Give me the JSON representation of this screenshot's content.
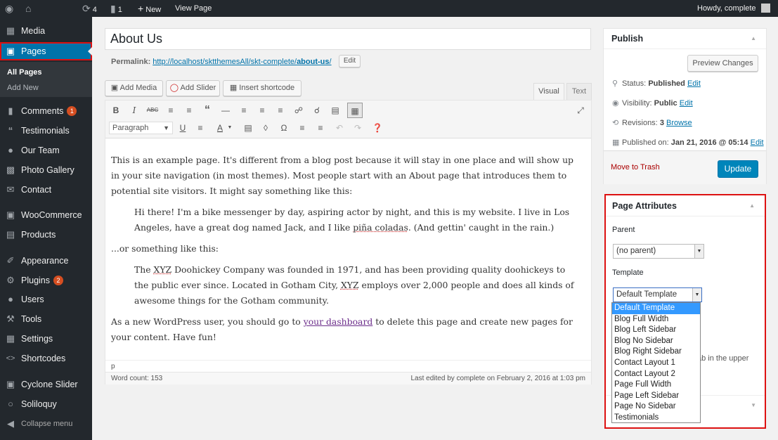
{
  "adminbar": {
    "updates_count": "4",
    "comments_count": "1",
    "new_label": "New",
    "view_page_label": "View Page",
    "howdy": "Howdy, complete"
  },
  "sidebar": {
    "items": [
      {
        "label": "Media",
        "icon": "media-icon"
      },
      {
        "label": "Pages",
        "icon": "pages-icon"
      },
      {
        "label": "Comments",
        "icon": "comments-icon",
        "badge": "1"
      },
      {
        "label": "Testimonials",
        "icon": "quote-icon"
      },
      {
        "label": "Our Team",
        "icon": "team-icon"
      },
      {
        "label": "Photo Gallery",
        "icon": "gallery-icon"
      },
      {
        "label": "Contact",
        "icon": "envelope-icon"
      },
      {
        "label": "WooCommerce",
        "icon": "woocommerce-icon"
      },
      {
        "label": "Products",
        "icon": "cart-icon"
      },
      {
        "label": "Appearance",
        "icon": "brush-icon"
      },
      {
        "label": "Plugins",
        "icon": "plugin-icon",
        "badge": "2"
      },
      {
        "label": "Users",
        "icon": "user-icon"
      },
      {
        "label": "Tools",
        "icon": "wrench-icon"
      },
      {
        "label": "Settings",
        "icon": "settings-icon"
      },
      {
        "label": "Shortcodes",
        "icon": "code-icon"
      },
      {
        "label": "Cyclone Slider",
        "icon": "slider-icon"
      },
      {
        "label": "Soliloquy",
        "icon": "soliloquy-icon"
      },
      {
        "label": "Collapse menu",
        "icon": "collapse-icon"
      }
    ],
    "submenu": {
      "all_pages": "All Pages",
      "add_new": "Add New"
    }
  },
  "editor": {
    "title": "About Us",
    "permalink_label": "Permalink:",
    "permalink_base": "http://localhost/sktthemesAll/skt-complete/",
    "permalink_slug": "about-us",
    "permalink_tail": "/",
    "edit_label": "Edit",
    "add_media": "Add Media",
    "add_slider": "Add Slider",
    "insert_shortcode": "Insert shortcode",
    "tab_visual": "Visual",
    "tab_text": "Text",
    "format": "Paragraph",
    "content": {
      "p1": "This is an example page. It's different from a blog post because it will stay in one place and will show up in your site navigation (in most themes). Most people start with an About page that introduces them to potential site visitors. It might say something like this:",
      "quote1_a": "Hi there! I'm a bike messenger by day, aspiring actor by night, and this is my website. I live in Los Angeles, have a great dog named Jack, and I like ",
      "quote1_b": "piña coladas",
      "quote1_c": ". (And gettin' caught in the rain.)",
      "p2": "...or something like this:",
      "quote2_a": "The ",
      "quote2_b": "XYZ",
      "quote2_c": " Doohickey Company was founded in 1971, and has been providing quality doohickeys to the public ever since. Located in Gotham City, ",
      "quote2_d": "XYZ",
      "quote2_e": " employs over 2,000 people and does all kinds of awesome things for the Gotham community.",
      "p3_a": "As a new WordPress user, you should go to ",
      "p3_link": "your dashboard",
      "p3_b": " to delete this page and create new pages for your content. Have fun!"
    },
    "path": "p",
    "word_count": "Word count: 153",
    "last_edited": "Last edited by complete on February 2, 2016 at 1:03 pm"
  },
  "publish": {
    "title": "Publish",
    "preview": "Preview Changes",
    "status_label": "Status:",
    "status_value": "Published",
    "visibility_label": "Visibility:",
    "visibility_value": "Public",
    "revisions_label": "Revisions:",
    "revisions_value": "3",
    "browse": "Browse",
    "published_label": "Published on:",
    "published_value": "Jan 21, 2016 @ 05:14",
    "edit": "Edit",
    "trash": "Move to Trash",
    "update": "Update"
  },
  "attributes": {
    "title": "Page Attributes",
    "parent_label": "Parent",
    "parent_value": "(no parent)",
    "template_label": "Template",
    "template_value": "Default Template",
    "help_fragment": "ab in the upper",
    "template_options": [
      "Default Template",
      "Blog Full Width",
      "Blog Left Sidebar",
      "Blog No Sidebar",
      "Blog Right Sidebar",
      "Contact Layout 1",
      "Contact Layout 2",
      "Page Full Width",
      "Page Left Sidebar",
      "Page No Sidebar",
      "Testimonials"
    ]
  }
}
